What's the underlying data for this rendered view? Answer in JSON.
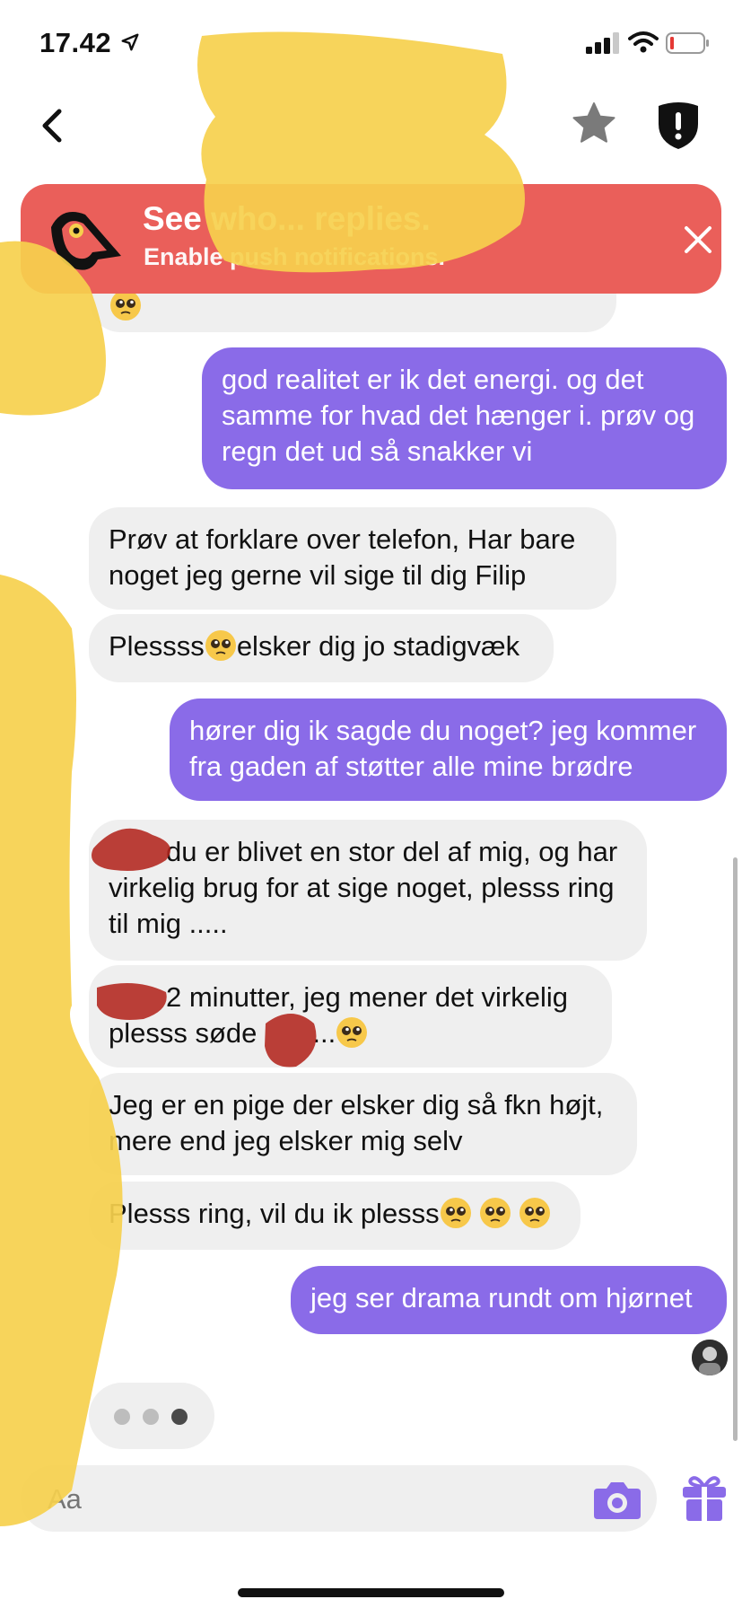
{
  "status_bar": {
    "time": "17.42"
  },
  "banner": {
    "title": "See who... replies.",
    "subtitle": "Enable push notifications."
  },
  "colors": {
    "outgoing_bubble": "#8a6be8",
    "incoming_bubble": "#efefef",
    "banner_bg": "#ea5f5a",
    "accent": "#8a6be8",
    "redaction_yellow": "#f6d04d",
    "redaction_red": "#b3261e"
  },
  "messages": [
    {
      "direction": "in",
      "text": "god realitet er ik det energi. og det samme for hvad det hænger i. prøv og regn det ud så snakker vi",
      "note": ""
    },
    {
      "direction": "out",
      "text": "god realitet er ik det energi. og det samme for hvad det hænger i. prøv og regn det ud så snakker vi"
    },
    {
      "direction": "in",
      "text": "Prøv at forklare over telefon, Har bare noget jeg gerne vil sige til dig Filip"
    },
    {
      "direction": "in",
      "text_before": "Plessss",
      "text_after": "elsker dig jo stadigvæk"
    },
    {
      "direction": "out",
      "text": "hører dig ik sagde du noget? jeg kommer fra gaden af støtter alle mine brødre"
    },
    {
      "direction": "in",
      "text": "du er blivet en stor del af mig, og har virkelig brug for at sige noget, plesss ring til mig ....."
    },
    {
      "direction": "in",
      "line1": "2 minutter, jeg mener det virkelig",
      "line2_before": "plesss søde",
      "line2_after": "..."
    },
    {
      "direction": "in",
      "text": "Jeg er en pige der elsker dig så fkn højt, mere end jeg elsker mig selv"
    },
    {
      "direction": "in",
      "text": "Plesss ring, vil du ik plesss"
    },
    {
      "direction": "out",
      "text": "jeg ser drama rundt om hjørnet"
    }
  ],
  "composer": {
    "placeholder": "Aa"
  },
  "icons": {
    "back": "chevron-left-icon",
    "star": "star-icon",
    "shield": "shield-alert-icon",
    "close": "close-icon",
    "camera": "camera-icon",
    "gift": "gift-icon",
    "pleading_face": "pleading-face-emoji"
  }
}
